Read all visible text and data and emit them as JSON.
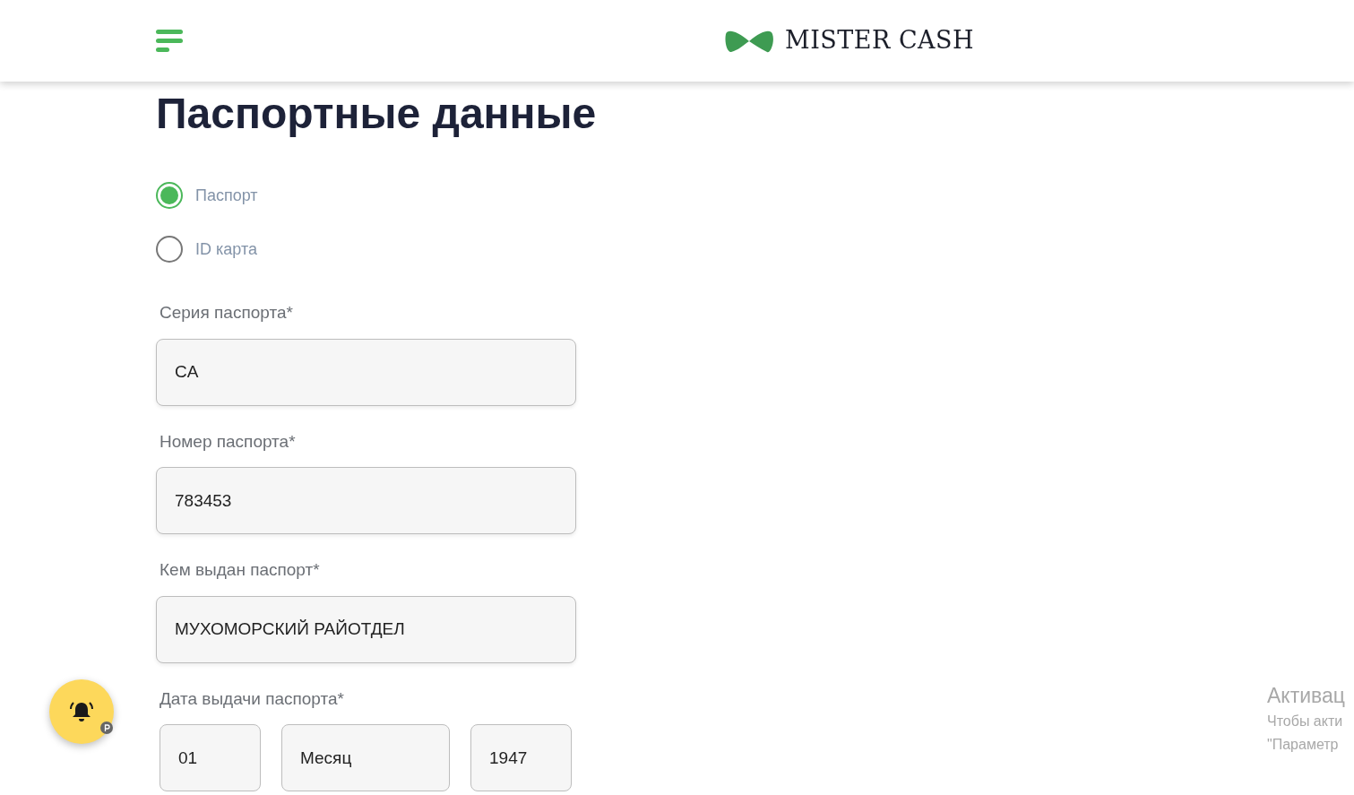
{
  "header": {
    "logo_text": "MISTER CASH"
  },
  "title": "Паспортные данные",
  "document_types": [
    {
      "label": "Паспорт",
      "selected": true
    },
    {
      "label": "ID карта",
      "selected": false
    }
  ],
  "fields": [
    {
      "kind": "text",
      "label": "Серия паспорта*",
      "value": "CA"
    },
    {
      "kind": "text",
      "label": "Номер паспорта*",
      "value": "783453"
    },
    {
      "kind": "text",
      "label": "Кем выдан паспорт*",
      "value": "МУХОМОРСКИЙ РАЙОТДЕЛ"
    },
    {
      "kind": "date",
      "label": "Дата выдачи паспорта*",
      "parts": [
        {
          "value": "01"
        },
        {
          "value": "Месяц"
        },
        {
          "value": "1947"
        }
      ]
    }
  ],
  "os_notice": {
    "title": "Активац",
    "lines": [
      "Чтобы акти",
      "\"Параметр"
    ]
  }
}
